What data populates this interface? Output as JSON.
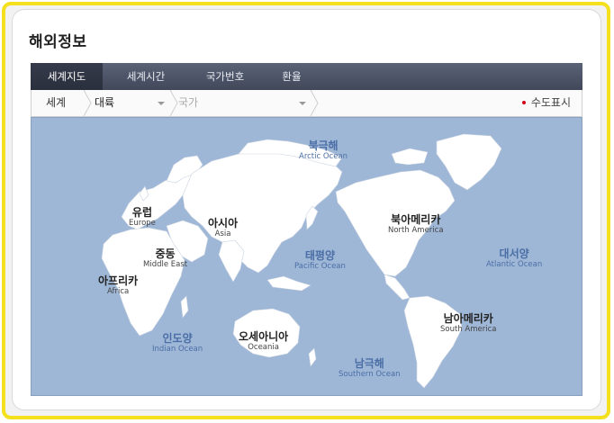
{
  "section_title": "해외정보",
  "tabs": [
    {
      "label": "세계지도",
      "active": true
    },
    {
      "label": "세계시간",
      "active": false
    },
    {
      "label": "국가번호",
      "active": false
    },
    {
      "label": "환율",
      "active": false
    }
  ],
  "filter": {
    "breadcrumb": "세계",
    "continent_select": "대륙",
    "country_select": "국가",
    "capital_toggle": "수도표시"
  },
  "map_labels": {
    "europe": {
      "ko": "유럽",
      "en": "Europe"
    },
    "asia": {
      "ko": "아시아",
      "en": "Asia"
    },
    "middle_east": {
      "ko": "중동",
      "en": "Middle East"
    },
    "africa": {
      "ko": "아프리카",
      "en": "Africa"
    },
    "oceania": {
      "ko": "오세아니아",
      "en": "Oceania"
    },
    "north_america": {
      "ko": "북아메리카",
      "en": "North America"
    },
    "south_america": {
      "ko": "남아메리카",
      "en": "South America"
    },
    "arctic": {
      "ko": "북극해",
      "en": "Arctic Ocean"
    },
    "pacific": {
      "ko": "태평양",
      "en": "Pacific Ocean"
    },
    "atlantic": {
      "ko": "대서양",
      "en": "Atlantic Ocean"
    },
    "indian": {
      "ko": "인도양",
      "en": "Indian Ocean"
    },
    "southern": {
      "ko": "남극해",
      "en": "Southern Ocean"
    }
  },
  "colors": {
    "frame": "#f4e01c",
    "tab_bar": "#4a5164",
    "ocean": "#9fb7d7",
    "land": "#ffffff",
    "ocean_label": "#4a6ea5",
    "capital_dot": "#d0021b"
  }
}
